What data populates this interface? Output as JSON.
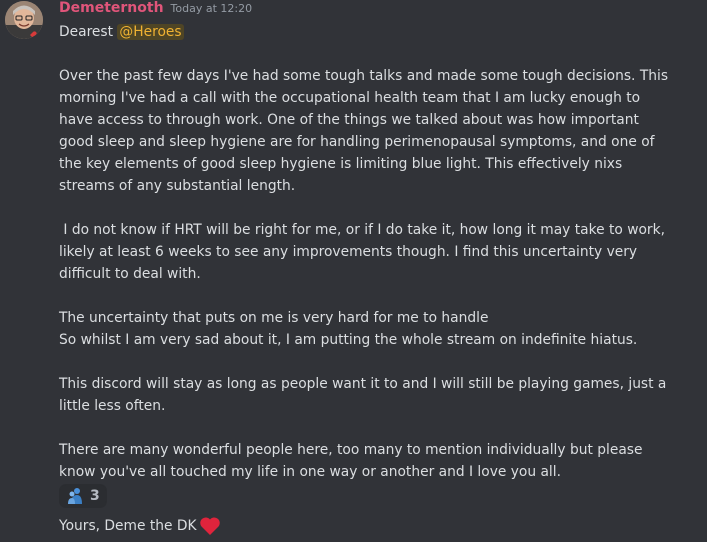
{
  "message": {
    "username": "Demeternoth",
    "timestamp": "Today at 12:20",
    "username_color": "#e0557a",
    "greeting_prefix": "Dearest ",
    "mention": "@Heroes",
    "paragraphs": [
      [
        "Over the past few days I've had some tough talks and made some tough decisions. This",
        "morning I've had a call with the occupational health team that I am lucky enough to",
        "have access to through work. One of the things we talked about was how important",
        "good sleep and sleep hygiene are for handling perimenopausal symptoms, and one of",
        "the key elements of good sleep hygiene is limiting blue light. This effectively nixs",
        "streams of any substantial length."
      ],
      [
        " I do not know if HRT will be right for me, or if I do take it, how long it may take to work,",
        "likely at least 6 weeks to see any improvements though. I find this uncertainty very",
        "difficult to deal with."
      ],
      [
        "The uncertainty that puts on me is very hard for me to handle",
        "So whilst I am very sad about it, I am putting the whole stream on indefinite hiatus."
      ],
      [
        "This discord will stay as long as people want it to and I will still be playing games, just a",
        "little less often."
      ],
      [
        "There are many wonderful people here, too many to mention individually but please",
        "know you've all touched my life in one way or another and I love you all."
      ]
    ],
    "signoff": "Yours, Deme the DK",
    "signoff_emoji": "heart-emoji"
  },
  "reactions": [
    {
      "emoji": "hugging-person-emoji",
      "count": "3"
    }
  ],
  "colors": {
    "background": "#313338",
    "text": "#dbdee1",
    "mention_bg": "#4f4525",
    "mention_text": "#f0b232",
    "heart": "#e0243c"
  }
}
